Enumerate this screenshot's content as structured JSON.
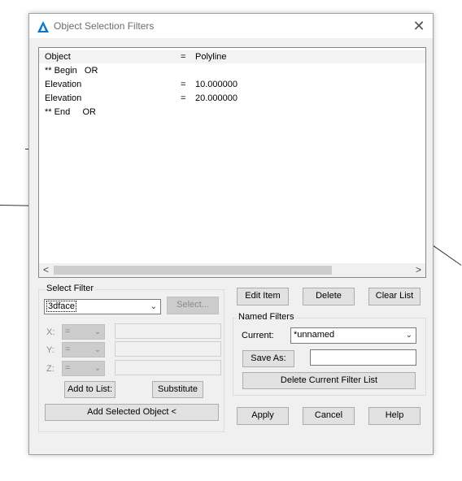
{
  "dialog": {
    "title": "Object Selection Filters",
    "close_icon": "close-icon",
    "app_icon": "autocad-triangle-icon"
  },
  "filter_list": {
    "rows": [
      {
        "name": "Object",
        "op": "=",
        "value": "Polyline"
      },
      {
        "name": "** Begin   OR",
        "op": "",
        "value": ""
      },
      {
        "name": "Elevation",
        "op": "=",
        "value": "10.000000"
      },
      {
        "name": "Elevation",
        "op": "=",
        "value": "20.000000"
      },
      {
        "name": "** End     OR",
        "op": "",
        "value": ""
      }
    ],
    "scroll_left": "<",
    "scroll_right": ">"
  },
  "select_filter": {
    "group_label": "Select Filter",
    "type_value": "3dface",
    "select_button": "Select...",
    "x_label": "X:",
    "y_label": "Y:",
    "z_label": "Z:",
    "op_value": "=",
    "add_to_list": "Add to List:",
    "substitute": "Substitute",
    "add_selected_object": "Add Selected Object <"
  },
  "list_buttons": {
    "edit_item": "Edit Item",
    "delete": "Delete",
    "clear_list": "Clear List"
  },
  "named_filters": {
    "group_label": "Named Filters",
    "current_label": "Current:",
    "current_value": "*unnamed",
    "save_as": "Save As:",
    "save_as_value": "",
    "delete_current": "Delete Current Filter List"
  },
  "footer": {
    "apply": "Apply",
    "cancel": "Cancel",
    "help": "Help"
  }
}
